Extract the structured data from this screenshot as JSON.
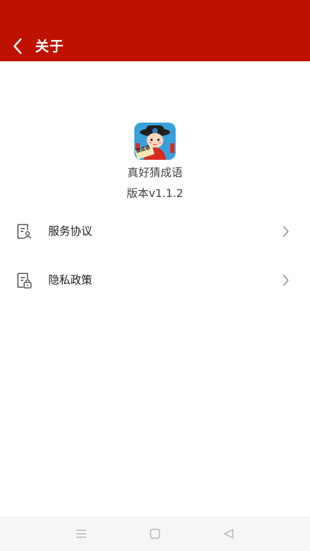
{
  "header": {
    "title": "关于",
    "back_icon": "chevron-left-icon",
    "background_color": "#be1100"
  },
  "app_info": {
    "icon": "app-logo-icon",
    "icon_badge_text": "猜成语",
    "name": "真好猜成语",
    "version": "版本v1.1.2"
  },
  "menu": {
    "items": [
      {
        "label": "服务协议",
        "icon": "user-document-icon",
        "chevron": "chevron-right-icon"
      },
      {
        "label": "隐私政策",
        "icon": "lock-document-icon",
        "chevron": "chevron-right-icon"
      }
    ]
  },
  "system_nav": {
    "buttons": [
      {
        "icon": "menu-lines-icon"
      },
      {
        "icon": "home-square-icon"
      },
      {
        "icon": "back-triangle-icon"
      }
    ]
  }
}
